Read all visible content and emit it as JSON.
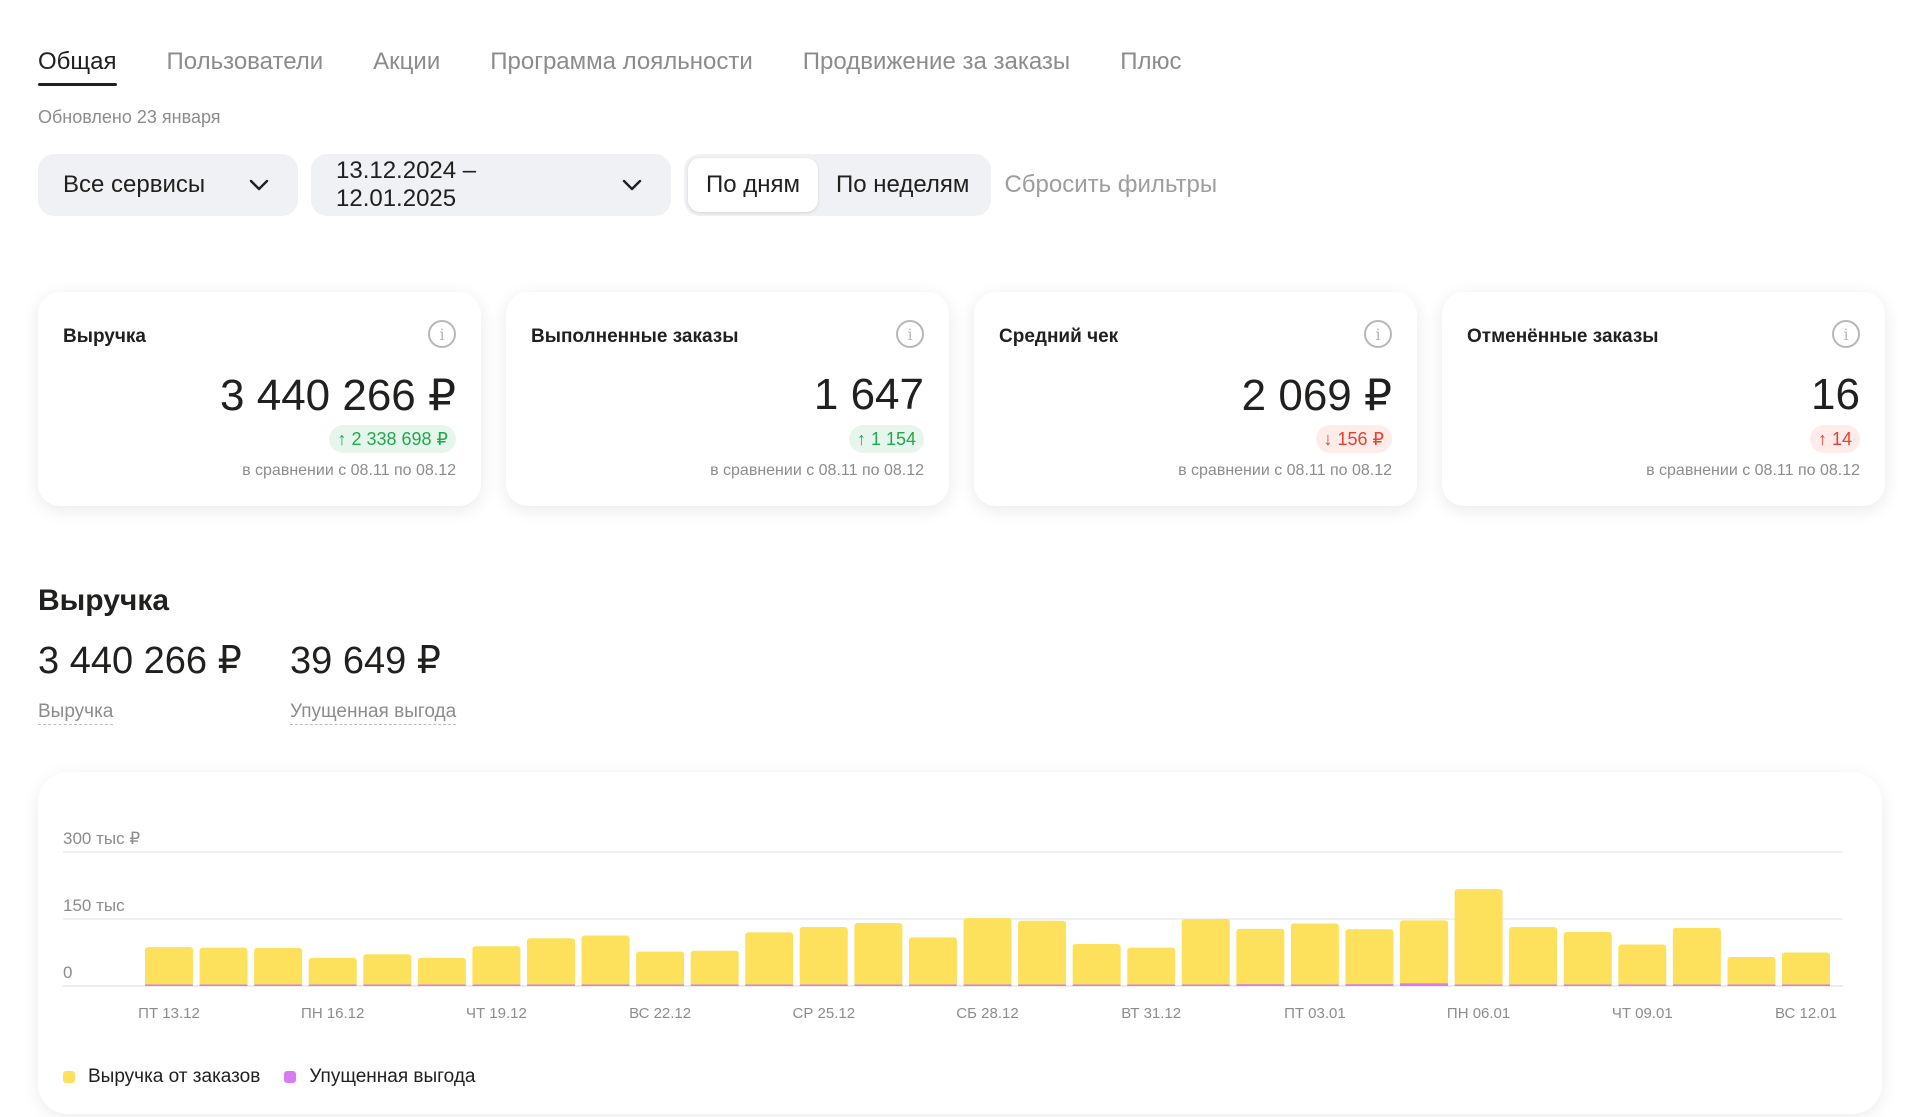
{
  "tabs": [
    {
      "label": "Общая",
      "active": true
    },
    {
      "label": "Пользователи"
    },
    {
      "label": "Акции"
    },
    {
      "label": "Программа лояльности"
    },
    {
      "label": "Продвижение за заказы"
    },
    {
      "label": "Плюс"
    }
  ],
  "updated": "Обновлено 23 января",
  "filters": {
    "services": "Все сервисы",
    "dates": "13.12.2024 – 12.01.2025",
    "period_day": "По дням",
    "period_week": "По неделям",
    "period_selected": "По дням",
    "reset": "Сбросить фильтры"
  },
  "cards": [
    {
      "title": "Выручка",
      "value": "3 440 266 ₽",
      "delta": "↑ 2 338 698 ₽",
      "trend": "up",
      "compare": "в сравнении с 08.11 по 08.12"
    },
    {
      "title": "Выполненные заказы",
      "value": "1 647",
      "delta": "↑ 1 154",
      "trend": "up",
      "compare": "в сравнении с 08.11 по 08.12"
    },
    {
      "title": "Средний чек",
      "value": "2 069 ₽",
      "delta": "↓ 156 ₽",
      "trend": "down",
      "compare": "в сравнении с 08.11 по 08.12"
    },
    {
      "title": "Отменённые заказы",
      "value": "16",
      "delta": "↑ 14",
      "trend": "bad-up",
      "compare": "в сравнении с 08.11 по 08.12"
    }
  ],
  "revenue": {
    "title": "Выручка",
    "total": "3 440 266 ₽",
    "total_label": "Выручка",
    "lost": "39 649 ₽",
    "lost_label": "Упущенная выгода"
  },
  "colors": {
    "revenue": "#fde15c",
    "lost": "#d97cf1",
    "positive": "#22a84c",
    "negative": "#e8412d"
  },
  "chart_data": {
    "type": "bar",
    "stacked": true,
    "y_ticks": [
      "0",
      "150 тыс",
      "300 тыс ₽"
    ],
    "ylim": [
      0,
      300000
    ],
    "grid": true,
    "x_tick_labels": [
      "ПТ 13.12",
      "ПН 16.12",
      "ЧТ 19.12",
      "ВС 22.12",
      "СР 25.12",
      "СБ 28.12",
      "ВТ 31.12",
      "ПТ 03.01",
      "ПН 06.01",
      "ЧТ 09.01",
      "ВС 12.01"
    ],
    "x_tick_every": 3,
    "categories": [
      "13.12",
      "14.12",
      "15.12",
      "16.12",
      "17.12",
      "18.12",
      "19.12",
      "20.12",
      "21.12",
      "22.12",
      "23.12",
      "24.12",
      "25.12",
      "26.12",
      "27.12",
      "28.12",
      "29.12",
      "30.12",
      "31.12",
      "01.01",
      "02.01",
      "03.01",
      "04.01",
      "05.01",
      "06.01",
      "07.01",
      "08.01",
      "09.01",
      "10.01",
      "11.01",
      "12.01"
    ],
    "series": [
      {
        "name": "Выручка от заказов",
        "values": [
          87000,
          86000,
          85000,
          63000,
          71000,
          63000,
          89000,
          107000,
          113000,
          77000,
          79000,
          120000,
          132000,
          141000,
          109000,
          152000,
          146000,
          94000,
          86000,
          150000,
          128000,
          140000,
          127000,
          147000,
          217000,
          132000,
          121000,
          93000,
          130000,
          65000,
          75000
        ]
      },
      {
        "name": "Упущенная выгода",
        "values": [
          2000,
          500,
          1000,
          500,
          500,
          500,
          500,
          500,
          500,
          500,
          500,
          3000,
          1000,
          500,
          500,
          500,
          500,
          500,
          500,
          3000,
          4000,
          1000,
          4000,
          6000,
          2000,
          500,
          3000,
          1000,
          3000,
          500,
          500
        ]
      }
    ],
    "legend_position": "bottom-left"
  }
}
